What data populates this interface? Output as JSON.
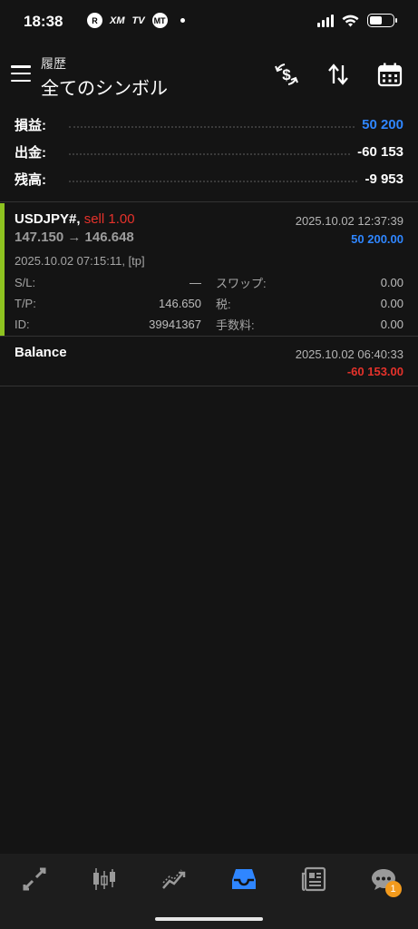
{
  "status_bar": {
    "time": "18:38",
    "apps": [
      "R",
      "XM",
      "TV",
      "MT"
    ]
  },
  "header": {
    "subtitle": "履歴",
    "title": "全てのシンボル"
  },
  "summary": [
    {
      "label": "損益:",
      "value": "50 200",
      "color": "#2f86ff"
    },
    {
      "label": "出金:",
      "value": "-60 153",
      "color": "#ffffff"
    },
    {
      "label": "残高:",
      "value": "-9 953",
      "color": "#ffffff"
    }
  ],
  "trade": {
    "symbol": "USDJPY#,",
    "side": "sell 1.00",
    "prices": "147.150 → 146.648",
    "close_time": "2025.10.02 12:37:39",
    "profit": "50 200.00",
    "open_time": "2025.10.02 07:15:11, [tp]",
    "rows": [
      {
        "label1": "S/L:",
        "value1": "—",
        "label2": "スワップ:",
        "value2": "0.00"
      },
      {
        "label1": "T/P:",
        "value1": "146.650",
        "label2": "税:",
        "value2": "0.00"
      },
      {
        "label1": "ID:",
        "value1": "39941367",
        "label2": "手数料:",
        "value2": "0.00"
      }
    ]
  },
  "balance": {
    "label": "Balance",
    "time": "2025.10.02 06:40:33",
    "value": "-60 153.00"
  },
  "bottom_nav": {
    "items": [
      "trade-icon",
      "chart-icon",
      "trend-icon",
      "history-icon",
      "news-icon",
      "chat-icon"
    ],
    "active": "history-icon",
    "chat_badge": "1"
  }
}
